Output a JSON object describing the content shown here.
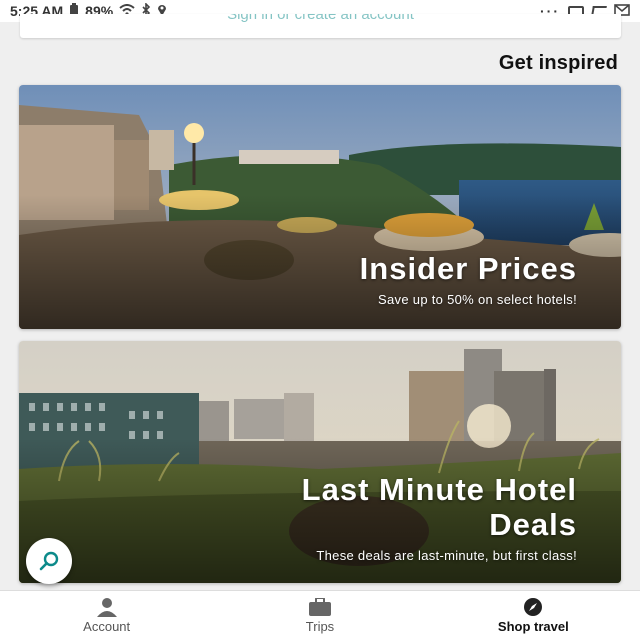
{
  "status_bar": {
    "time": "5:25 AM",
    "battery": "89%",
    "overflow": "···"
  },
  "signin_card": {
    "text": "Sign in or create an account"
  },
  "section": {
    "title": "Get inspired"
  },
  "promos": [
    {
      "title": "Insider Prices",
      "subtitle": "Save up to 50% on select hotels!"
    },
    {
      "title_line1": "Last Minute Hotel",
      "title_line2": "Deals",
      "subtitle": "These deals are last-minute, but first class!"
    }
  ],
  "fab": {
    "icon": "search-icon"
  },
  "bottom_nav": {
    "items": [
      {
        "label": "Account",
        "icon": "person-icon"
      },
      {
        "label": "Trips",
        "icon": "suitcase-icon"
      },
      {
        "label": "Shop travel",
        "icon": "compass-icon"
      }
    ]
  },
  "colors": {
    "accent": "#0c8a8a",
    "background": "#efefef"
  }
}
